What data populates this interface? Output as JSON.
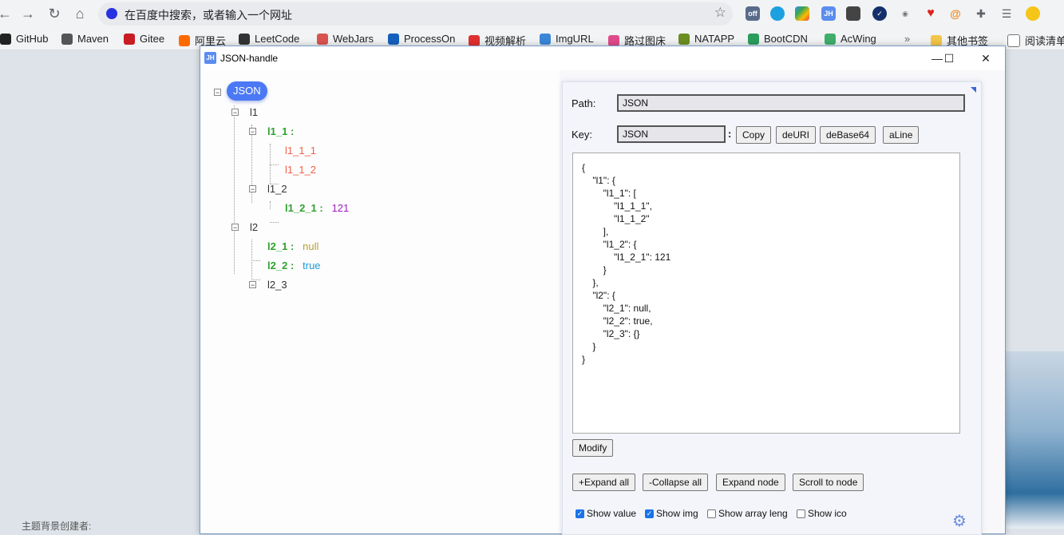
{
  "browser": {
    "address_text": "在百度中搜索，或者输入一个网址",
    "ext_off_badge": "off",
    "ext_jh": "JH",
    "bookmarks": [
      {
        "label": "GitHub",
        "color": "#222222"
      },
      {
        "label": "Maven",
        "color": "#555555"
      },
      {
        "label": "Gitee",
        "color": "#c71d23"
      },
      {
        "label": "阿里云",
        "color": "#ff6a00"
      },
      {
        "label": "LeetCode",
        "color": "#333333"
      },
      {
        "label": "WebJars",
        "color": "#d9534f"
      },
      {
        "label": "ProcessOn",
        "color": "#1560bd"
      },
      {
        "label": "视频解析",
        "color": "#e03030"
      },
      {
        "label": "ImgURL",
        "color": "#3a86d8"
      },
      {
        "label": "路过图床",
        "color": "#e04a8a"
      },
      {
        "label": "NATAPP",
        "color": "#6b8e23"
      },
      {
        "label": "BootCDN",
        "color": "#2a9d5c"
      },
      {
        "label": "AcWing",
        "color": "#3fae6a"
      }
    ],
    "bookmarks_more": "»",
    "other_bookmarks": "其他书签",
    "reading_list": "阅读清单"
  },
  "background": {
    "footer_text": "主题背景创建者:"
  },
  "window": {
    "logo": "JH",
    "title": "JSON-handle",
    "min": "—",
    "max": "☐",
    "close": "✕"
  },
  "tree": {
    "root": "JSON",
    "colon": ":",
    "nodes": {
      "l1": "l1",
      "l1_1": "l1_1",
      "l1_1_1": "l1_1_1",
      "l1_1_2": "l1_1_2",
      "l1_2": "l1_2",
      "l1_2_1": "l1_2_1",
      "l1_2_1_val": "121",
      "l2": "l2",
      "l2_1": "l2_1",
      "l2_1_val": "null",
      "l2_2": "l2_2",
      "l2_2_val": "true",
      "l2_3": "l2_3"
    }
  },
  "panel": {
    "path_label": "Path:",
    "path_value": "JSON",
    "key_label": "Key:",
    "key_value": "JSON",
    "key_colon": ":",
    "buttons": {
      "copy": "Copy",
      "deuri": "deURI",
      "debase64": "deBase64",
      "aline": "aLine"
    },
    "json_text": "{\n    \"l1\": {\n        \"l1_1\": [\n            \"l1_1_1\",\n            \"l1_1_2\"\n        ],\n        \"l1_2\": {\n            \"l1_2_1\": 121\n        }\n    },\n    \"l2\": {\n        \"l2_1\": null,\n        \"l2_2\": true,\n        \"l2_3\": {}\n    }\n}",
    "modify": "Modify",
    "expand_all": "+Expand all",
    "collapse_all": "-Collapse all",
    "expand_node": "Expand node",
    "scroll_to_node": "Scroll to node",
    "options": [
      {
        "label": "Show value",
        "checked": true
      },
      {
        "label": "Show img",
        "checked": true
      },
      {
        "label": "Show array leng",
        "checked": false
      },
      {
        "label": "Show ico",
        "checked": false
      }
    ]
  },
  "colors": {
    "accent": "#4b79f5",
    "key_green": "#2fa12f",
    "array_item": "#f06048",
    "number": "#a020c0",
    "null": "#b8a030",
    "bool": "#1c9ad6"
  }
}
